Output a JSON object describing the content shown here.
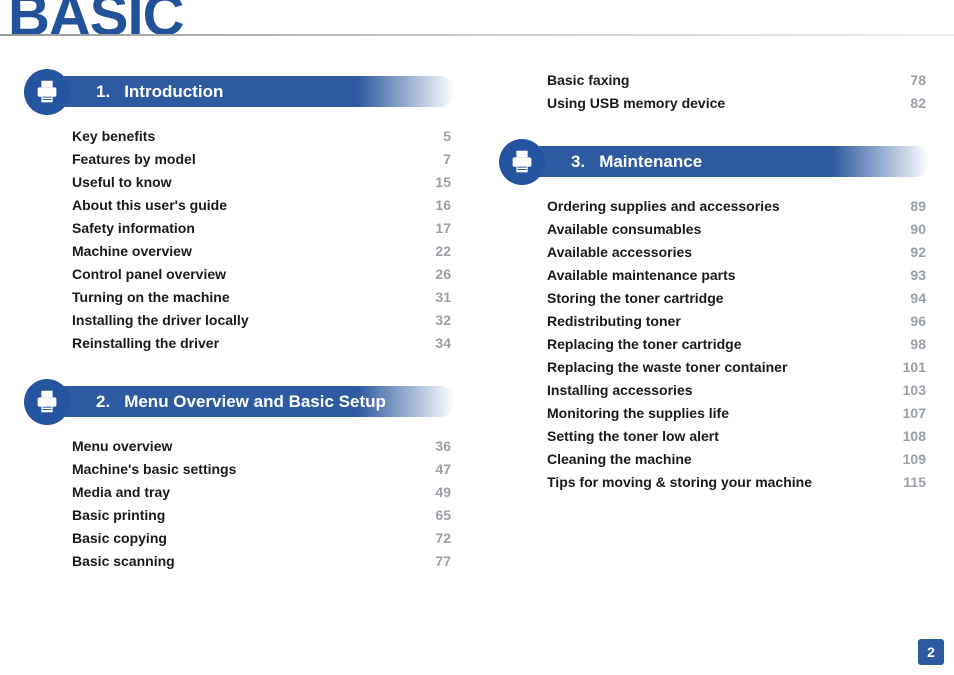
{
  "title": "BASIC",
  "page_number": "2",
  "left": {
    "chapter1": {
      "num": "1.",
      "title": "Introduction"
    },
    "chapter2": {
      "num": "2.",
      "title": "Menu Overview and Basic Setup"
    },
    "ch1_items": [
      {
        "t": "Key benefits",
        "p": "5"
      },
      {
        "t": "Features by model",
        "p": "7"
      },
      {
        "t": "Useful to know",
        "p": "15"
      },
      {
        "t": "About this user's guide",
        "p": "16"
      },
      {
        "t": "Safety information",
        "p": "17"
      },
      {
        "t": "Machine overview",
        "p": "22"
      },
      {
        "t": "Control panel overview",
        "p": "26"
      },
      {
        "t": " Turning on the machine",
        "p": "31"
      },
      {
        "t": "Installing the driver locally",
        "p": "32"
      },
      {
        "t": "Reinstalling the driver",
        "p": "34"
      }
    ],
    "ch2_items": [
      {
        "t": "Menu overview",
        "p": "36"
      },
      {
        "t": "Machine's basic settings",
        "p": "47"
      },
      {
        "t": "Media and tray",
        "p": "49"
      },
      {
        "t": "Basic printing",
        "p": "65"
      },
      {
        "t": "Basic copying",
        "p": "72"
      },
      {
        "t": "Basic scanning",
        "p": "77"
      }
    ]
  },
  "right": {
    "chapter3": {
      "num": "3.",
      "title": "Maintenance"
    },
    "ch2_cont": [
      {
        "t": "Basic faxing",
        "p": "78"
      },
      {
        "t": "Using USB memory device",
        "p": "82"
      }
    ],
    "ch3_items": [
      {
        "t": "Ordering supplies and accessories",
        "p": "89"
      },
      {
        "t": "Available consumables",
        "p": "90"
      },
      {
        "t": "Available accessories",
        "p": "92"
      },
      {
        "t": "Available maintenance parts",
        "p": "93"
      },
      {
        "t": "Storing the toner cartridge",
        "p": "94"
      },
      {
        "t": "Redistributing toner",
        "p": "96"
      },
      {
        "t": "Replacing the toner cartridge",
        "p": "98"
      },
      {
        "t": "Replacing the waste toner container",
        "p": "101"
      },
      {
        "t": "Installing accessories",
        "p": "103"
      },
      {
        "t": "Monitoring the supplies life",
        "p": "107"
      },
      {
        "t": "Setting the toner low alert",
        "p": "108"
      },
      {
        "t": "Cleaning the machine",
        "p": "109"
      },
      {
        "t": "Tips for moving & storing your machine",
        "p": "115"
      }
    ]
  }
}
